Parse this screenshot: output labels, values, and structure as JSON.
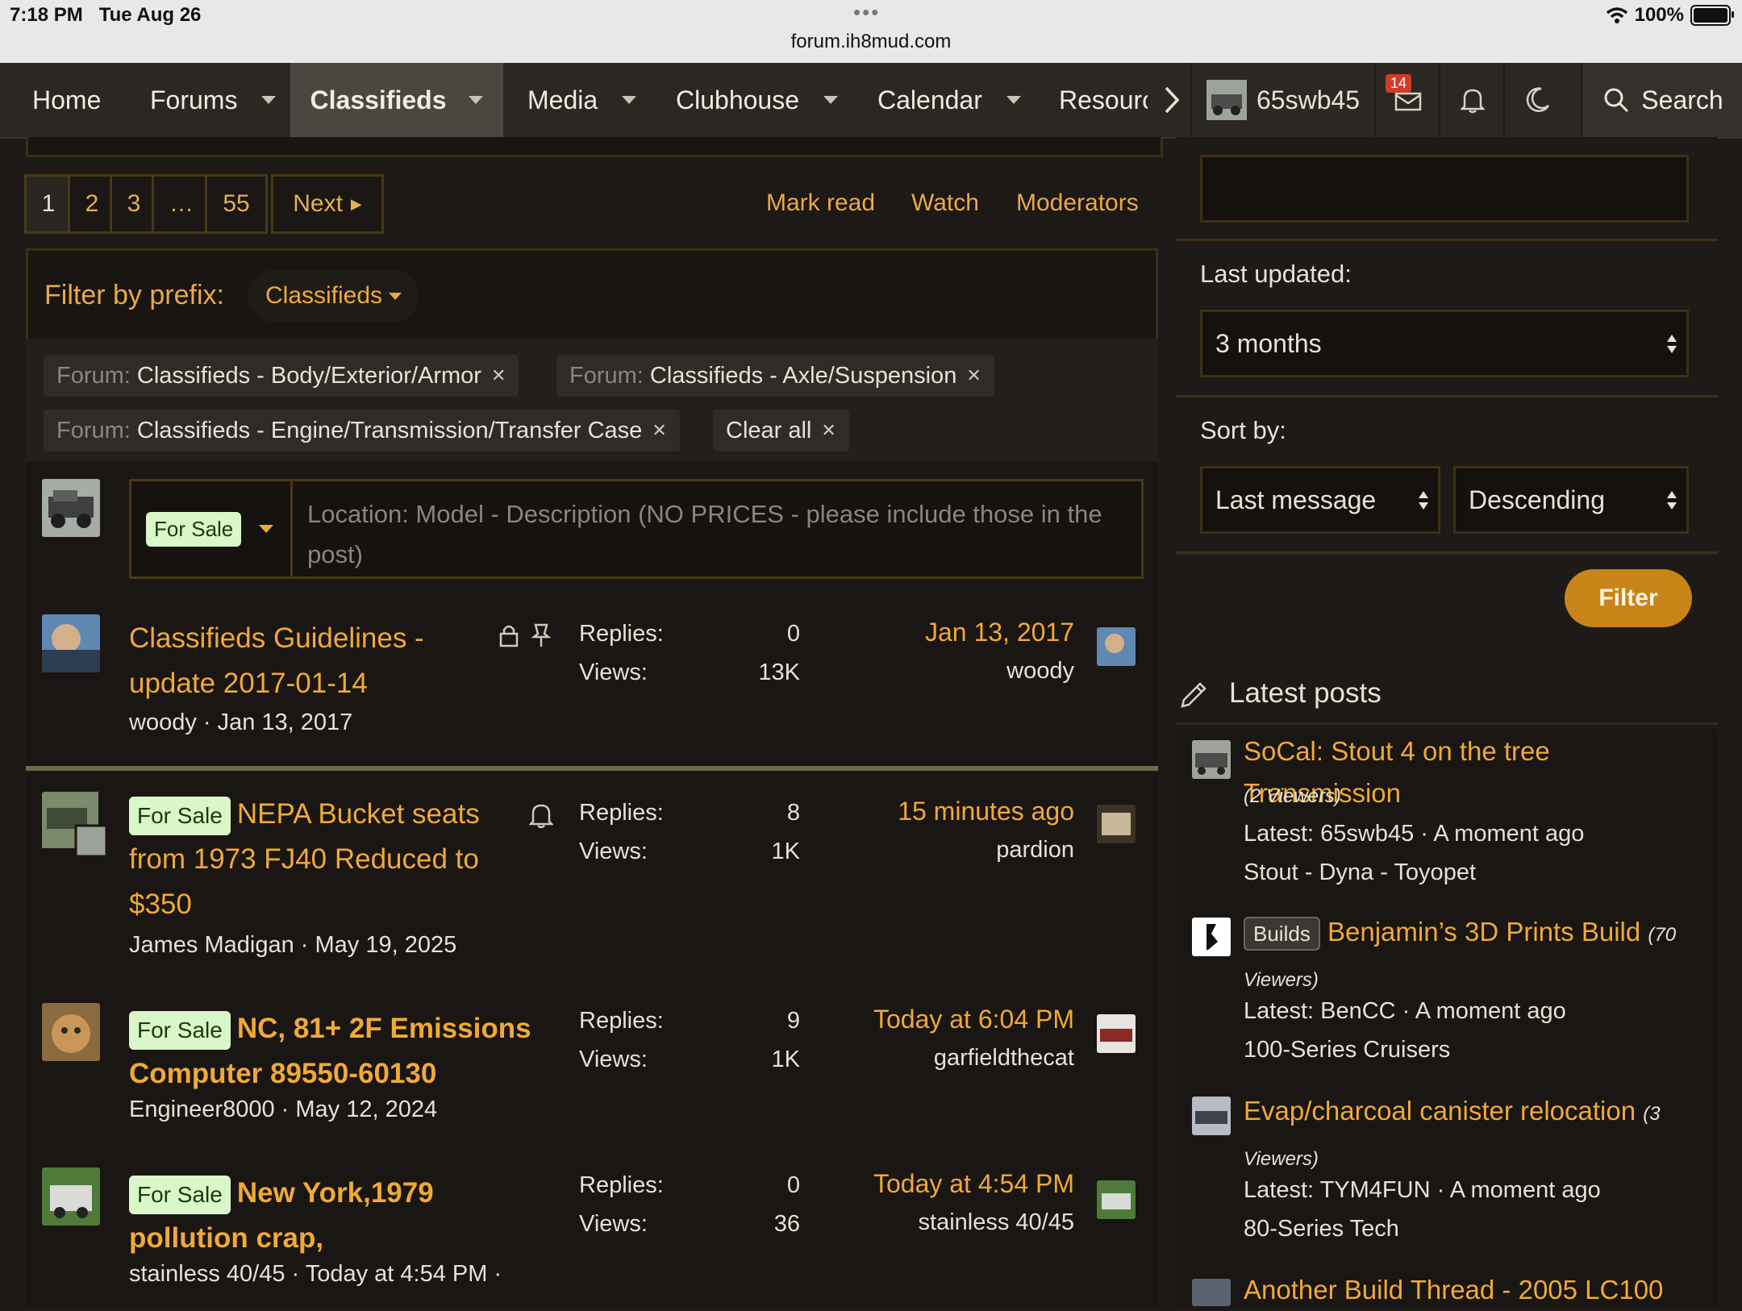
{
  "status": {
    "time": "7:18 PM",
    "date": "Tue Aug 26",
    "url": "forum.ih8mud.com",
    "battery": "100%"
  },
  "nav": {
    "items": [
      "Home",
      "Forums",
      "Classifieds",
      "Media",
      "Clubhouse",
      "Calendar",
      "Resourc"
    ],
    "active": "Classifieds",
    "username": "65swb45",
    "inbox_count": "14",
    "search_label": "Search"
  },
  "pagination": {
    "pages": [
      "1",
      "2",
      "3",
      "…",
      "55"
    ],
    "next": "Next",
    "current": "1"
  },
  "actions": {
    "mark_read": "Mark read",
    "watch": "Watch",
    "moderators": "Moderators"
  },
  "filter": {
    "label": "Filter by prefix:",
    "prefix": "Classifieds",
    "chips": [
      {
        "k": "Forum:",
        "v": "Classifieds - Body/Exterior/Armor"
      },
      {
        "k": "Forum:",
        "v": "Classifieds - Axle/Suspension"
      },
      {
        "k": "Forum:",
        "v": "Classifieds - Engine/Transmission/Transfer Case"
      }
    ],
    "clear_all": "Clear all"
  },
  "new_thread": {
    "prefix": "For Sale",
    "placeholder": "Location: Model - Description (NO PRICES - please include those in the post)"
  },
  "threads": [
    {
      "prefix": "",
      "title": "Classifieds Guidelines - update 2017-01-14",
      "author": "woody",
      "date": "Jan 13, 2017",
      "replies": "0",
      "views": "13K",
      "last_when": "Jan 13, 2017",
      "last_who": "woody"
    },
    {
      "prefix": "For Sale",
      "title": "NEPA Bucket seats from 1973 FJ40 Reduced to $350",
      "author": "James Madigan",
      "date": "May 19, 2025",
      "replies": "8",
      "views": "1K",
      "last_when": "15 minutes ago",
      "last_who": "pardion"
    },
    {
      "prefix": "For Sale",
      "title": "NC, 81+ 2F Emissions Computer 89550-60130",
      "author": "Engineer8000",
      "date": "May 12, 2024",
      "replies": "9",
      "views": "1K",
      "last_when": "Today at 6:04 PM",
      "last_who": "garfieldthecat"
    },
    {
      "prefix": "For Sale",
      "title": "New York,1979 pollution crap,",
      "author": "stainless 40/45",
      "date": "Today at 4:54 PM ·",
      "replies": "0",
      "views": "36",
      "last_when": "Today at 4:54 PM",
      "last_who": "stainless 40/45"
    }
  ],
  "labels": {
    "replies": "Replies:",
    "views": "Views:"
  },
  "sidebar": {
    "last_updated_label": "Last updated:",
    "last_updated_value": "3 months",
    "sort_by_label": "Sort by:",
    "sort_field": "Last message",
    "sort_dir": "Descending",
    "filter_button": "Filter",
    "latest_heading": "Latest posts",
    "posts": [
      {
        "prefix": "",
        "title": "SoCal: Stout 4 on the tree Transmission",
        "viewers": "(2 Viewers)",
        "latest": "Latest: 65swb45 · A moment ago",
        "forum": "Stout - Dyna - Toyopet"
      },
      {
        "prefix": "Builds",
        "title": "Benjamin’s 3D Prints Build",
        "viewers": "(70 Viewers)",
        "latest": "Latest: BenCC · A moment ago",
        "forum": "100-Series Cruisers"
      },
      {
        "prefix": "",
        "title": "Evap/charcoal canister relocation",
        "viewers": "(3 Viewers)",
        "latest": "Latest: TYM4FUN · A moment ago",
        "forum": "80-Series Tech"
      },
      {
        "prefix": "",
        "title": "Another Build Thread - 2005 LC100",
        "viewers": "",
        "latest": "",
        "forum": ""
      }
    ]
  }
}
